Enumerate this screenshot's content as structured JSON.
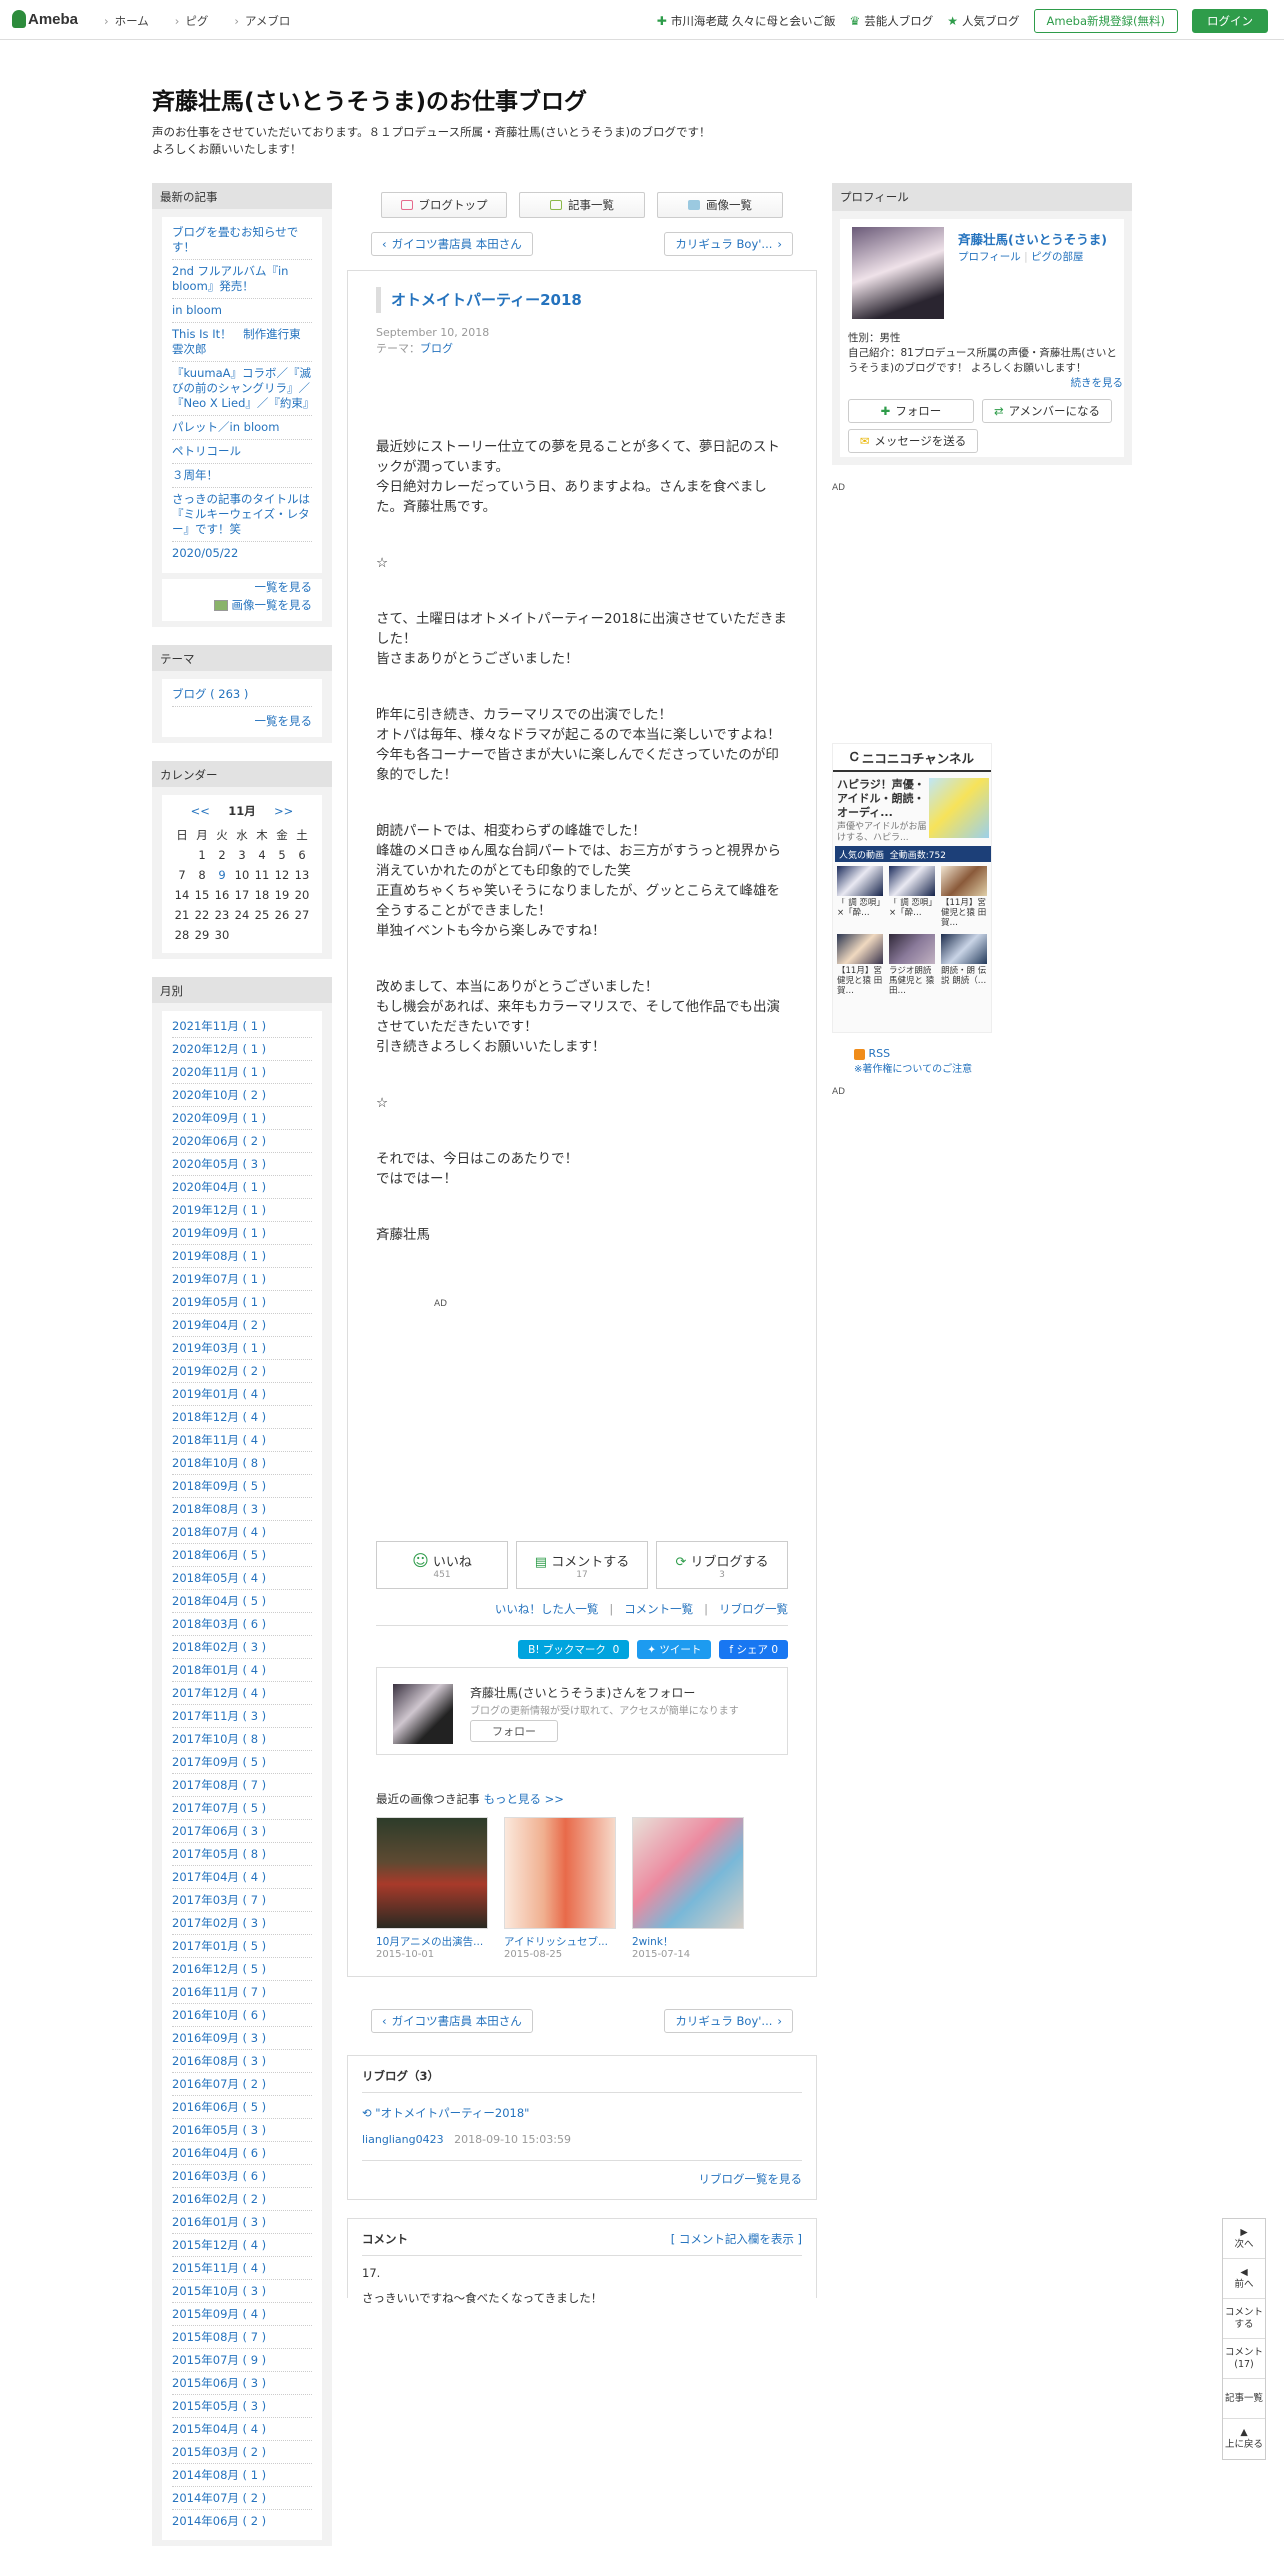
{
  "header": {
    "logo": "Ameba",
    "nav": [
      "ホーム",
      "ピグ",
      "アメブロ"
    ],
    "right": [
      {
        "icon": "plus-icon",
        "label": "市川海老蔵 久々に母と会いご飯"
      },
      {
        "icon": "crown-icon",
        "label": "芸能人ブログ"
      },
      {
        "icon": "star-icon",
        "label": "人気ブログ"
      }
    ],
    "register": "Ameba新規登録(無料)",
    "login": "ログイン"
  },
  "blog": {
    "title": "斉藤壮馬(さいとうそうま)のお仕事ブログ",
    "desc1": "声のお仕事をさせていただいております。８１プロデュース所属・斉藤壮馬(さいとうそうま)のブログです！",
    "desc2": "よろしくお願いいたします！"
  },
  "latest": {
    "title": "最新の記事",
    "items": [
      "ブログを畳むお知らせです！",
      "2nd フルアルバム『in bloom』発売！",
      "in bloom",
      "This Is It！　制作進行東雲次郎",
      "『kuumaA』コラボ／『滅びの前のシャングリラ』／『Neo X Lied』／『約束』",
      "パレット／in bloom",
      "ペトリコール",
      "３周年！",
      "さっきの記事のタイトルは『ミルキーウェイズ・レター』です！笑",
      "2020/05/22"
    ],
    "more": "一覧を見る",
    "imgmore": "画像一覧を見る"
  },
  "theme": {
    "title": "テーマ",
    "items": [
      "ブログ ( 263 )"
    ],
    "more": "一覧を見る"
  },
  "calendar": {
    "title": "カレンダー",
    "prev": "<<",
    "month": "11月",
    "next": ">>",
    "dow": [
      "日",
      "月",
      "火",
      "水",
      "木",
      "金",
      "土"
    ],
    "weeks": [
      [
        "",
        "1",
        "2",
        "3",
        "4",
        "5",
        "6"
      ],
      [
        "7",
        "8",
        "9",
        "10",
        "11",
        "12",
        "13"
      ],
      [
        "14",
        "15",
        "16",
        "17",
        "18",
        "19",
        "20"
      ],
      [
        "21",
        "22",
        "23",
        "24",
        "25",
        "26",
        "27"
      ],
      [
        "28",
        "29",
        "30",
        "",
        "",
        "",
        ""
      ]
    ],
    "link_day": "9"
  },
  "monthly": {
    "title": "月別",
    "items": [
      "2021年11月 ( 1 )",
      "2020年12月 ( 1 )",
      "2020年11月 ( 1 )",
      "2020年10月 ( 2 )",
      "2020年09月 ( 1 )",
      "2020年06月 ( 2 )",
      "2020年05月 ( 3 )",
      "2020年04月 ( 1 )",
      "2019年12月 ( 1 )",
      "2019年09月 ( 1 )",
      "2019年08月 ( 1 )",
      "2019年07月 ( 1 )",
      "2019年05月 ( 1 )",
      "2019年04月 ( 2 )",
      "2019年03月 ( 1 )",
      "2019年02月 ( 2 )",
      "2019年01月 ( 4 )",
      "2018年12月 ( 4 )",
      "2018年11月 ( 4 )",
      "2018年10月 ( 8 )",
      "2018年09月 ( 5 )",
      "2018年08月 ( 3 )",
      "2018年07月 ( 4 )",
      "2018年06月 ( 5 )",
      "2018年05月 ( 4 )",
      "2018年04月 ( 5 )",
      "2018年03月 ( 6 )",
      "2018年02月 ( 3 )",
      "2018年01月 ( 4 )",
      "2017年12月 ( 4 )",
      "2017年11月 ( 3 )",
      "2017年10月 ( 8 )",
      "2017年09月 ( 5 )",
      "2017年08月 ( 7 )",
      "2017年07月 ( 5 )",
      "2017年06月 ( 3 )",
      "2017年05月 ( 8 )",
      "2017年04月 ( 4 )",
      "2017年03月 ( 7 )",
      "2017年02月 ( 3 )",
      "2017年01月 ( 5 )",
      "2016年12月 ( 5 )",
      "2016年11月 ( 7 )",
      "2016年10月 ( 6 )",
      "2016年09月 ( 3 )",
      "2016年08月 ( 3 )",
      "2016年07月 ( 2 )",
      "2016年06月 ( 5 )",
      "2016年05月 ( 3 )",
      "2016年04月 ( 6 )",
      "2016年03月 ( 6 )",
      "2016年02月 ( 2 )",
      "2016年01月 ( 3 )",
      "2015年12月 ( 4 )",
      "2015年11月 ( 4 )",
      "2015年10月 ( 3 )",
      "2015年09月 ( 4 )",
      "2015年08月 ( 7 )",
      "2015年07月 ( 9 )",
      "2015年06月 ( 3 )",
      "2015年05月 ( 3 )",
      "2015年04月 ( 4 )",
      "2015年03月 ( 2 )",
      "2014年08月 ( 1 )",
      "2014年07月 ( 2 )",
      "2014年06月 ( 2 )"
    ]
  },
  "tabs": [
    "ブログトップ",
    "記事一覧",
    "画像一覧"
  ],
  "pager": {
    "prev": "ガイコツ書店員 本田さん",
    "next": "カリギュラ Boy'..."
  },
  "article": {
    "title": "オトメイトパーティー2018",
    "date": "September 10, 2018",
    "theme_label": "テーマ：",
    "theme": "ブログ",
    "paragraphs": [
      "最近妙にストーリー仕立ての夢を見ることが多くて、夢日記のストックが潤っています。\n今日絶対カレーだっていう日、ありますよね。さんまを食べました。斉藤壮馬です。",
      "☆",
      "さて、土曜日はオトメイトパーティー2018に出演させていただきました！\n皆さまありがとうございました！",
      "昨年に引き続き、カラーマリスでの出演でした！\nオトパは毎年、様々なドラマが起こるので本当に楽しいですよね！\n今年も各コーナーで皆さまが大いに楽しんでくださっていたのが印象的でした！",
      "朗読パートでは、相変わらずの峰雄でした！\n峰雄のメロきゅん風な台詞パートでは、お三方がすうっと視界から消えていかれたのがとても印象的でした笑\n正直めちゃくちゃ笑いそうになりましたが、グッとこらえて峰雄を全うすることができました！\n単独イベントも今から楽しみですね！",
      "改めまして、本当にありがとうございました！\nもし機会があれば、来年もカラーマリスで、そして他作品でも出演させていただきたいです！\n引き続きよろしくお願いいたします！",
      "☆",
      "それでは、今日はこのあたりで！\nではではー！",
      "斉藤壮馬"
    ],
    "ad": "AD"
  },
  "reactions": {
    "like": "いいね",
    "like_count": "451",
    "comment": "コメントする",
    "comment_count": "17",
    "reblog": "リブログする",
    "reblog_count": "3",
    "links": [
      "いいね！した人一覧",
      "コメント一覧",
      "リブログ一覧"
    ]
  },
  "share": {
    "hatena": "B! ブックマーク",
    "hatena_count": "0",
    "tweet": "ツイート",
    "fb": "シェア",
    "fb_count": "0"
  },
  "follow": {
    "name": "斉藤壮馬(さいとうそうま)さんをフォロー",
    "desc": "ブログの更新情報が受け取れて、アクセスが簡単になります",
    "button": "フォロー"
  },
  "recent": {
    "title": "最近の画像つき記事",
    "more": "もっと見る >>",
    "items": [
      {
        "title": "10月アニメの出演告...",
        "date": "2015-10-01"
      },
      {
        "title": "アイドリッシュセブ...",
        "date": "2015-08-25"
      },
      {
        "title": "2wink！",
        "date": "2015-07-14"
      }
    ]
  },
  "reblog": {
    "title": "リブログ（3）",
    "item": "\"オトメイトパーティー2018\"",
    "user": "liangliang0423",
    "time": "2018-09-10 15:03:59",
    "more": "リブログ一覧を見る"
  },
  "comments": {
    "title": "コメント",
    "link": "[ コメント記入欄を表示 ]",
    "num": "17.",
    "text": "さっきいいですね～食べたくなってきました！"
  },
  "profile": {
    "title": "プロフィール",
    "name": "斉藤壮馬(さいとうそうま)",
    "links": [
      "プロフィール",
      "ピグの部屋"
    ],
    "sex": "性別：男性",
    "intro": "自己紹介：81プロデュース所属の声優・斉藤壮馬(さいとうそうま)のブログです！ よろしくお願いします！",
    "more": "続きを見る",
    "follow": "フォロー",
    "member": "アメンバーになる",
    "message": "メッセージを送る"
  },
  "right_ad": "AD",
  "nico": {
    "brand": "ニコニコチャンネル",
    "headline": "ハピラジ！声優・アイドル・朗読・オーディ...",
    "sub": "声優やアイドルがお届けする、ハピラ...",
    "bar": "人気の動画",
    "count": "全動画数:752",
    "videos": [
      "「 調 恋唄」×「酔…",
      "「 調 恋唄」×「酔…",
      "【11月】宮 健児と猿 田賀…",
      "【11月】宮 健児と猿 田賀…",
      "ラジオ朗読 馬健児と 猿田…",
      "朗読・朗 伝説 朗読（…"
    ],
    "rss": "RSS",
    "notice": "※著作権についてのご注意",
    "ad": "AD"
  },
  "float_nav": [
    "次へ",
    "前へ",
    "コメントする",
    "コメント(17)",
    "記事一覧",
    "上に戻る"
  ],
  "float_nav_arrows": [
    "▶",
    "◀",
    "",
    "",
    "",
    "▲"
  ],
  "colors": {
    "accent": "#2573be",
    "green": "#2e9c4a",
    "panel": "#f2f2f2"
  }
}
